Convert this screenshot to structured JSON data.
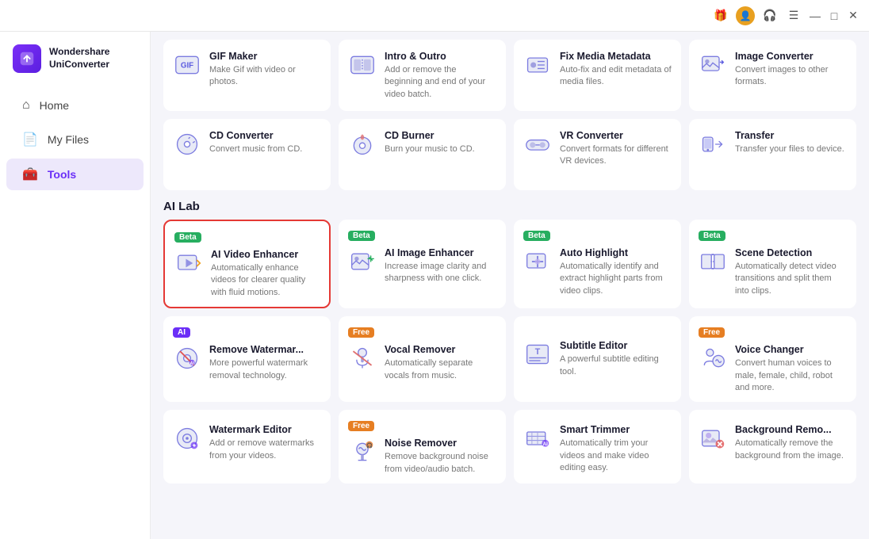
{
  "titlebar": {
    "gift_label": "🎁",
    "user_label": "👤",
    "headphone_label": "🎧",
    "menu_label": "☰",
    "minimize_label": "—",
    "maximize_label": "□",
    "close_label": "✕"
  },
  "sidebar": {
    "logo_line1": "Wondershare",
    "logo_line2": "UniConverter",
    "nav_items": [
      {
        "id": "home",
        "label": "Home",
        "icon": "⌂"
      },
      {
        "id": "my-files",
        "label": "My Files",
        "icon": "📄"
      },
      {
        "id": "tools",
        "label": "Tools",
        "icon": "🧰",
        "active": true
      }
    ]
  },
  "sections": [
    {
      "id": "top-tools",
      "label": "",
      "cards": [
        {
          "id": "gif-maker",
          "title": "GIF Maker",
          "desc": "Make Gif with video or photos.",
          "badge": null,
          "highlighted": false
        },
        {
          "id": "intro-outro",
          "title": "Intro & Outro",
          "desc": "Add or remove the beginning and end of your video batch.",
          "badge": null,
          "highlighted": false
        },
        {
          "id": "fix-media-metadata",
          "title": "Fix Media Metadata",
          "desc": "Auto-fix and edit metadata of media files.",
          "badge": null,
          "highlighted": false
        },
        {
          "id": "image-converter",
          "title": "Image Converter",
          "desc": "Convert images to other formats.",
          "badge": null,
          "highlighted": false
        }
      ]
    },
    {
      "id": "cd-tools",
      "label": "",
      "cards": [
        {
          "id": "cd-converter",
          "title": "CD Converter",
          "desc": "Convert music from CD.",
          "badge": null,
          "highlighted": false
        },
        {
          "id": "cd-burner",
          "title": "CD Burner",
          "desc": "Burn your music to CD.",
          "badge": null,
          "highlighted": false
        },
        {
          "id": "vr-converter",
          "title": "VR Converter",
          "desc": "Convert formats for different VR devices.",
          "badge": null,
          "highlighted": false
        },
        {
          "id": "transfer",
          "title": "Transfer",
          "desc": "Transfer your files to device.",
          "badge": null,
          "highlighted": false
        }
      ]
    },
    {
      "id": "ai-lab",
      "label": "AI Lab",
      "cards": [
        {
          "id": "ai-video-enhancer",
          "title": "AI Video Enhancer",
          "desc": "Automatically enhance videos for clearer quality with fluid motions.",
          "badge": "beta",
          "highlighted": true
        },
        {
          "id": "ai-image-enhancer",
          "title": "AI Image Enhancer",
          "desc": "Increase image clarity and sharpness with one click.",
          "badge": "beta",
          "highlighted": false
        },
        {
          "id": "auto-highlight",
          "title": "Auto Highlight",
          "desc": "Automatically identify and extract highlight parts from video clips.",
          "badge": "beta",
          "highlighted": false
        },
        {
          "id": "scene-detection",
          "title": "Scene Detection",
          "desc": "Automatically detect video transitions and split them into clips.",
          "badge": "beta",
          "highlighted": false
        }
      ]
    },
    {
      "id": "ai-tools",
      "label": "",
      "cards": [
        {
          "id": "remove-watermark",
          "title": "Remove Watermar...",
          "desc": "More powerful watermark removal technology.",
          "badge": "ai",
          "highlighted": false
        },
        {
          "id": "vocal-remover",
          "title": "Vocal Remover",
          "desc": "Automatically separate vocals from music.",
          "badge": "free",
          "highlighted": false
        },
        {
          "id": "subtitle-editor",
          "title": "Subtitle Editor",
          "desc": "A powerful subtitle editing tool.",
          "badge": null,
          "highlighted": false
        },
        {
          "id": "voice-changer",
          "title": "Voice Changer",
          "desc": "Convert human voices to male, female, child, robot and more.",
          "badge": "free",
          "highlighted": false
        }
      ]
    },
    {
      "id": "editor-tools",
      "label": "",
      "cards": [
        {
          "id": "watermark-editor",
          "title": "Watermark Editor",
          "desc": "Add or remove watermarks from your videos.",
          "badge": null,
          "highlighted": false
        },
        {
          "id": "noise-remover",
          "title": "Noise Remover",
          "desc": "Remove background noise from video/audio batch.",
          "badge": "free",
          "highlighted": false
        },
        {
          "id": "smart-trimmer",
          "title": "Smart Trimmer",
          "desc": "Automatically trim your videos and make video editing easy.",
          "badge": null,
          "highlighted": false
        },
        {
          "id": "background-remover",
          "title": "Background Remo...",
          "desc": "Automatically remove the background from the image.",
          "badge": null,
          "highlighted": false
        }
      ]
    }
  ]
}
